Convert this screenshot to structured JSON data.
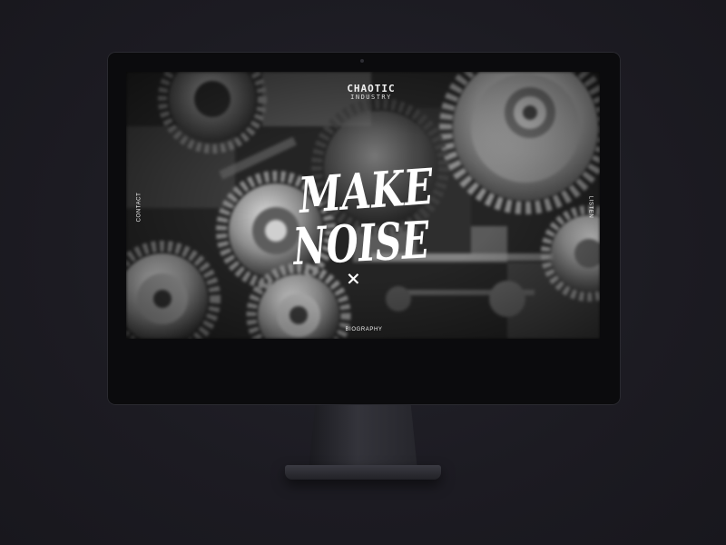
{
  "site": {
    "logo": {
      "top": "CHAOTIC",
      "bottom": "INDUSTRY"
    },
    "hero": {
      "line1": "MAKE",
      "line2": "NOISE",
      "mark": "×"
    },
    "nav": {
      "left": "CONTACT",
      "right": "LISTEN",
      "bottom": "BIOGRAPHY"
    }
  },
  "colors": {
    "background": "#1c1b22",
    "monitor_bezel": "#0b0b0d",
    "monitor_chin": "#2a2a30",
    "text": "#ffffff"
  },
  "icons": {
    "background_image": "gears-machinery-photo",
    "camera": "camera-dot"
  }
}
